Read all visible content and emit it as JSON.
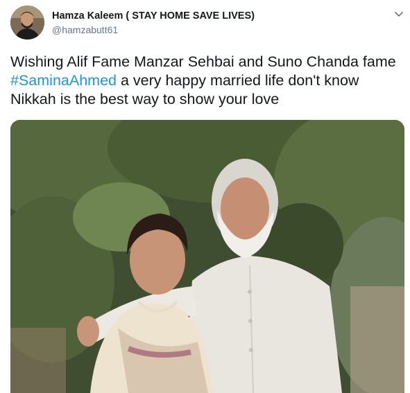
{
  "author": {
    "display_name": "Hamza Kaleem ( STAY HOME SAVE LIVES)",
    "handle": "@hamzabutt61"
  },
  "tweet": {
    "text_part1": "Wishing Alif Fame Manzar Sehbai and Suno Chanda fame ",
    "hashtag": "#SaminaAhmed",
    "text_part2": " a very happy married life don't know Nikkah is the best way to show your love"
  },
  "colors": {
    "hashtag": "#1b95e0",
    "handle": "#657786",
    "text": "#14171a"
  },
  "icons": {
    "menu": "chevron-down-icon"
  }
}
